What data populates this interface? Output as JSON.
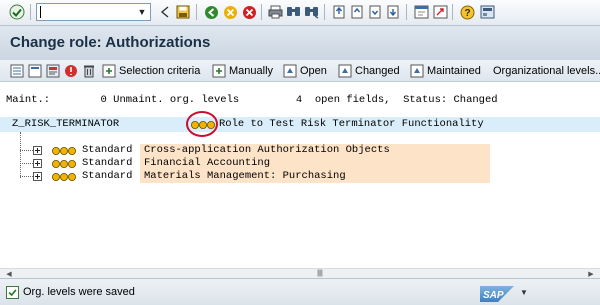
{
  "title": "Change role: Authorizations",
  "toolbar": {
    "selection_criteria": "Selection criteria",
    "manually": "Manually",
    "open": "Open",
    "changed": "Changed",
    "maintained": "Maintained",
    "org_levels": "Organizational levels..."
  },
  "status": {
    "maint_label": "Maint.:",
    "unmaint_count": "0",
    "unmaint_label": "Unmaint. org. levels",
    "open_count": "4",
    "open_label": "open fields,",
    "status_label": "Status: Changed"
  },
  "role": {
    "name": "Z_RISK_TERMINATOR",
    "description": "Role to Test Risk Terminator Functionality"
  },
  "nodes": [
    {
      "type": "Standard",
      "description": "Cross-application Authorization Objects"
    },
    {
      "type": "Standard",
      "description": "Financial Accounting"
    },
    {
      "type": "Standard",
      "description": "Materials Management: Purchasing"
    }
  ],
  "statusbar": {
    "message": "Org. levels were saved"
  },
  "colors": {
    "highlight_row": "#d9eefa",
    "node_bg": "#fde3c8",
    "annotation_circle": "#c8102e",
    "title_text": "#1b2f45"
  }
}
